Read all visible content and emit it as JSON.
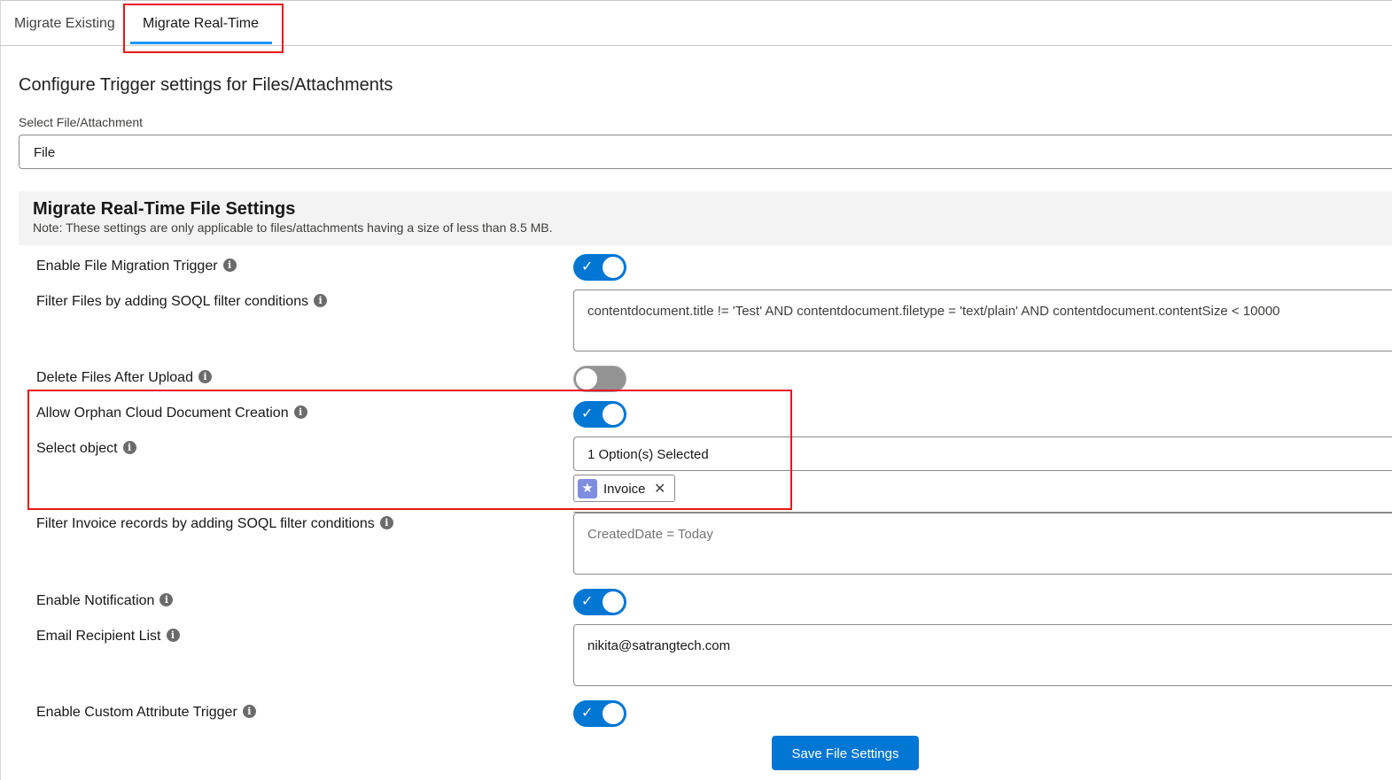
{
  "tabs": [
    {
      "label": "Migrate Existing"
    },
    {
      "label": "Migrate Real-Time"
    }
  ],
  "config": {
    "title": "Configure Trigger settings for Files/Attachments",
    "select_label": "Select File/Attachment",
    "select_value": "File"
  },
  "panel": {
    "title": "Migrate Real-Time File Settings",
    "note": "Note: These settings are only applicable to files/attachments having a size of less than 8.5 MB."
  },
  "rows": {
    "enable_trigger": {
      "label": "Enable File Migration Trigger",
      "on": true
    },
    "filter_files": {
      "label": "Filter Files by adding SOQL filter conditions",
      "value": "contentdocument.title != 'Test' AND contentdocument.filetype = 'text/plain' AND contentdocument.contentSize < 10000"
    },
    "delete_files": {
      "label": "Delete Files After Upload",
      "on": false
    },
    "allow_orphan": {
      "label": "Allow Orphan Cloud Document Creation",
      "on": true
    },
    "select_object": {
      "label": "Select object",
      "value": "1 Option(s) Selected",
      "pill": "Invoice"
    },
    "filter_invoice": {
      "label": "Filter Invoice records by adding SOQL filter conditions",
      "placeholder": "CreatedDate = Today"
    },
    "enable_notification": {
      "label": "Enable Notification",
      "on": true
    },
    "email_list": {
      "label": "Email Recipient List",
      "value": "nikita@satrangtech.com"
    },
    "custom_attr": {
      "label": "Enable Custom Attribute Trigger",
      "on": true
    }
  },
  "info_glyph": "i",
  "check_glyph": "✓",
  "close_glyph": "✕",
  "star_glyph": "★",
  "save_button": "Save File Settings",
  "colors": {
    "accent": "#0176d3",
    "highlight": "#e8171b",
    "tab_underline": "#1b96ff"
  }
}
